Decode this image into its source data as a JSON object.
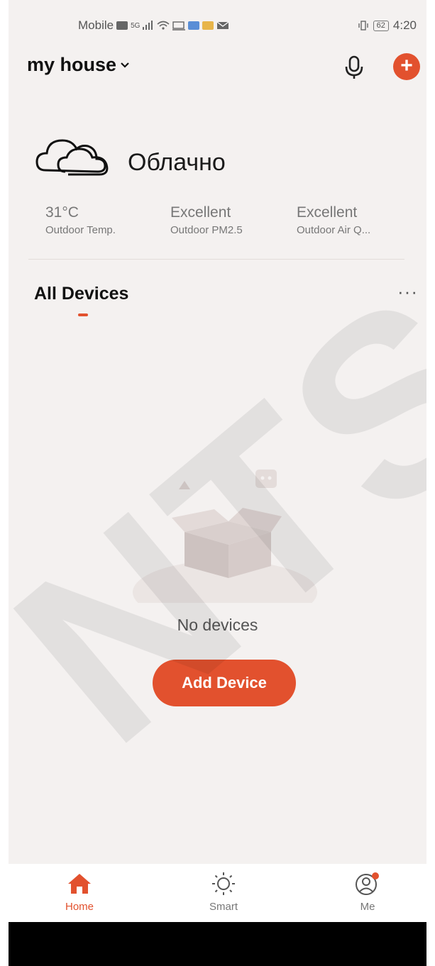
{
  "status_bar": {
    "carrier": "Mobile",
    "network": "5G",
    "battery": "62",
    "time": "4:20"
  },
  "header": {
    "home_name": "my house",
    "mic_icon": "microphone-icon",
    "add_icon": "plus-circle-icon"
  },
  "weather": {
    "icon": "cloud-icon",
    "condition": "Облачно",
    "stats": [
      {
        "value": "31°C",
        "label": "Outdoor Temp."
      },
      {
        "value": "Excellent",
        "label": "Outdoor PM2.5"
      },
      {
        "value": "Excellent",
        "label": "Outdoor Air Q..."
      }
    ]
  },
  "devices": {
    "tab_label": "All Devices",
    "more_label": "···",
    "empty_text": "No devices",
    "add_button": "Add Device"
  },
  "tabbar": {
    "items": [
      {
        "label": "Home",
        "icon": "home-icon",
        "active": true
      },
      {
        "label": "Smart",
        "icon": "sun-icon",
        "active": false
      },
      {
        "label": "Me",
        "icon": "user-icon",
        "active": false
      }
    ]
  },
  "watermark": "NTS",
  "colors": {
    "accent": "#e2512e",
    "background": "#f4f1f0",
    "muted_text": "#777777"
  }
}
